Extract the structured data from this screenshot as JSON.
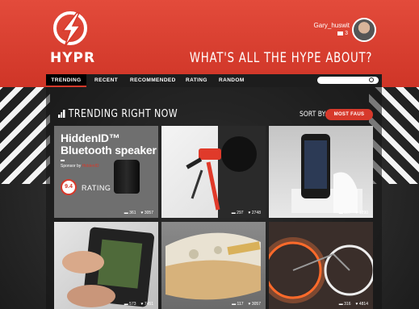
{
  "header": {
    "logo_text": "HYPR",
    "username": "Gary_huswit",
    "message_count": "3",
    "tagline": "WHAT'S ALL THE HYPE ABOUT?"
  },
  "nav": {
    "items": [
      {
        "label": "TRENDING",
        "active": true
      },
      {
        "label": "RECENT"
      },
      {
        "label": "RECOMMENDED"
      },
      {
        "label": "RATING"
      },
      {
        "label": "RANDOM"
      }
    ],
    "search_placeholder": ""
  },
  "section": {
    "title": "TRENDING RIGHT NOW",
    "sort_label": "SORT BY:",
    "sort_value": "MOST FAUS"
  },
  "tiles": [
    {
      "title": "HiddenID™ Bluetooth speaker",
      "sponsor_prefix": "Sponsor by",
      "sponsor_brand": "HiddenID",
      "rating": "9.4",
      "rating_label": "RATING",
      "comments": "361",
      "likes": "3057"
    },
    {
      "comments": "297",
      "likes": "2748"
    },
    {
      "comments": "507",
      "likes": "1290"
    },
    {
      "comments": "573",
      "likes": "7451"
    },
    {
      "comments": "117",
      "likes": "3057"
    },
    {
      "comments": "316",
      "likes": "4814"
    }
  ],
  "icons": {
    "comment": "▬",
    "heart": "♥"
  },
  "colors": {
    "accent": "#d7392b",
    "header": "#e34b3b",
    "nav": "#1d1d1d"
  }
}
